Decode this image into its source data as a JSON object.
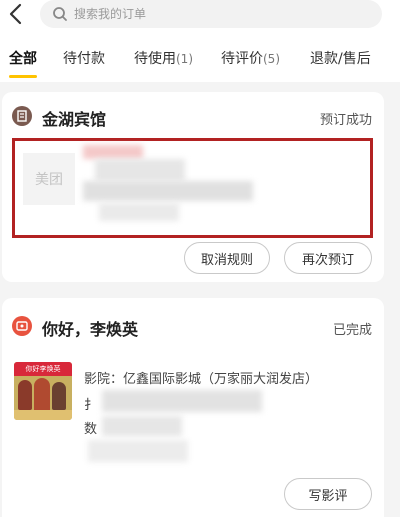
{
  "header": {
    "search_placeholder": "搜索我的订单"
  },
  "tabs": [
    {
      "label": "全部",
      "count": ""
    },
    {
      "label": "待付款",
      "count": ""
    },
    {
      "label": "待使用",
      "count": "(1)"
    },
    {
      "label": "待评价",
      "count": "(5)"
    },
    {
      "label": "退款/售后",
      "count": ""
    }
  ],
  "orders": [
    {
      "icon": "hotel-icon",
      "title": "金湖宾馆",
      "status": "预订成功",
      "thumb_text": "美团",
      "buttons": [
        "取消规则",
        "再次预订"
      ]
    },
    {
      "icon": "movie-icon",
      "title": "你好，李焕英",
      "status": "已完成",
      "cinema_line": "影院：亿鑫国际影城（万家丽大润发店）",
      "line_prefix_2": "扌",
      "line_prefix_3": "数",
      "poster_text": "你好李焕英",
      "buttons": [
        "写影评"
      ]
    }
  ],
  "colors": {
    "accent": "#ffc300",
    "highlight_border": "#b22222",
    "hotel_icon": "#7a5a50",
    "movie_icon": "#e8533f"
  }
}
